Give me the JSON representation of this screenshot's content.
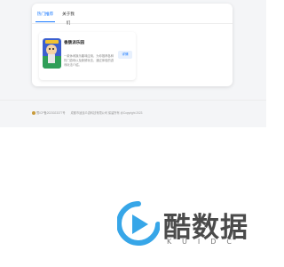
{
  "tabs": [
    {
      "label": "热门推荐",
      "active": true
    },
    {
      "label": "关于我们",
      "active": false
    }
  ],
  "game": {
    "title": "香肠派乐园",
    "description": "一款休闲娱乐趣味应用，为你推荐各种热门游戏以及新鲜玩法，通过体验的游戏玩法介绍。",
    "detail_button": "详情"
  },
  "footer": {
    "beian": "蜀ICP备2023023377号",
    "company": "成都市逍遥众游科技有限公司 保留所有",
    "copyright": "@Copyright 2023"
  },
  "watermark": {
    "text": "酷数据",
    "sub": "KUIDC"
  },
  "colors": {
    "accent": "#1677ff",
    "background": "#f4f5f7",
    "watermark_blue": "#37a6e8"
  }
}
